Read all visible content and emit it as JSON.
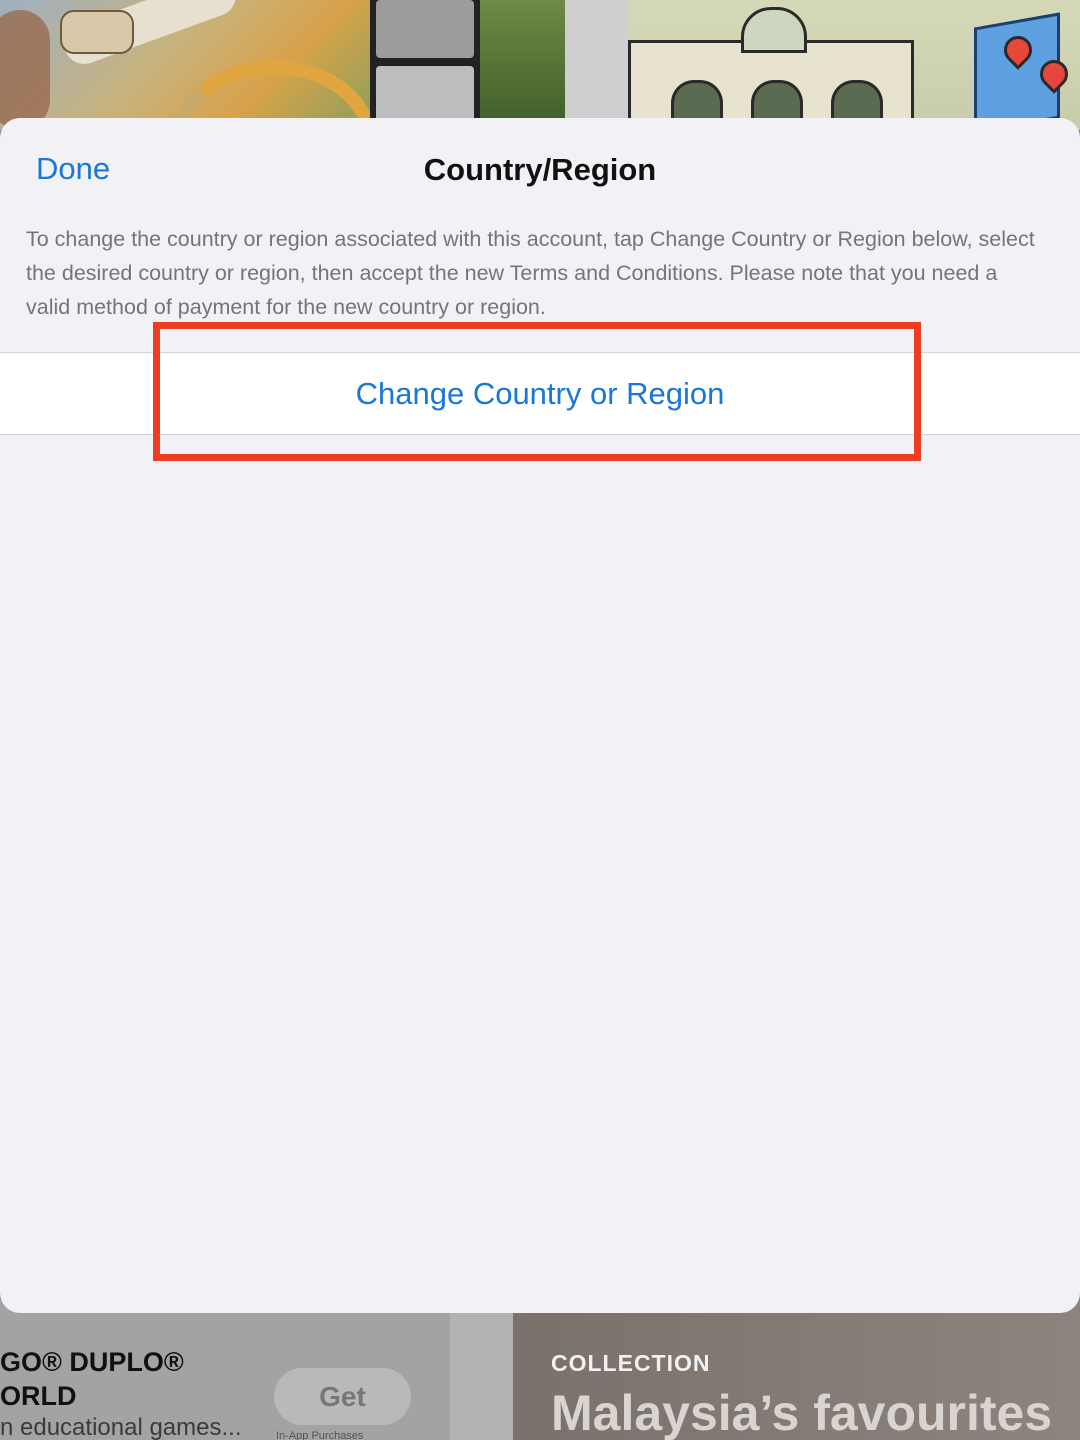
{
  "sheet": {
    "done_label": "Done",
    "title": "Country/Region",
    "description": "To change the country or region associated with this account, tap Change Country or Region below, select the desired country or region, then accept the new Terms and Conditions. Please note that you need a valid method of payment for the new country or region.",
    "action_label": "Change Country or Region"
  },
  "background": {
    "app_title": "GO® DUPLO®\nORLD",
    "app_subtitle": "n educational games...",
    "get_label": "Get",
    "in_app_label": "In-App Purchases",
    "collection_label": "COLLECTION",
    "collection_title": "Malaysia’s favourites"
  },
  "colors": {
    "accent": "#1877d8",
    "highlight": "#ee3d22",
    "sheet_bg": "#f2f2f6"
  }
}
